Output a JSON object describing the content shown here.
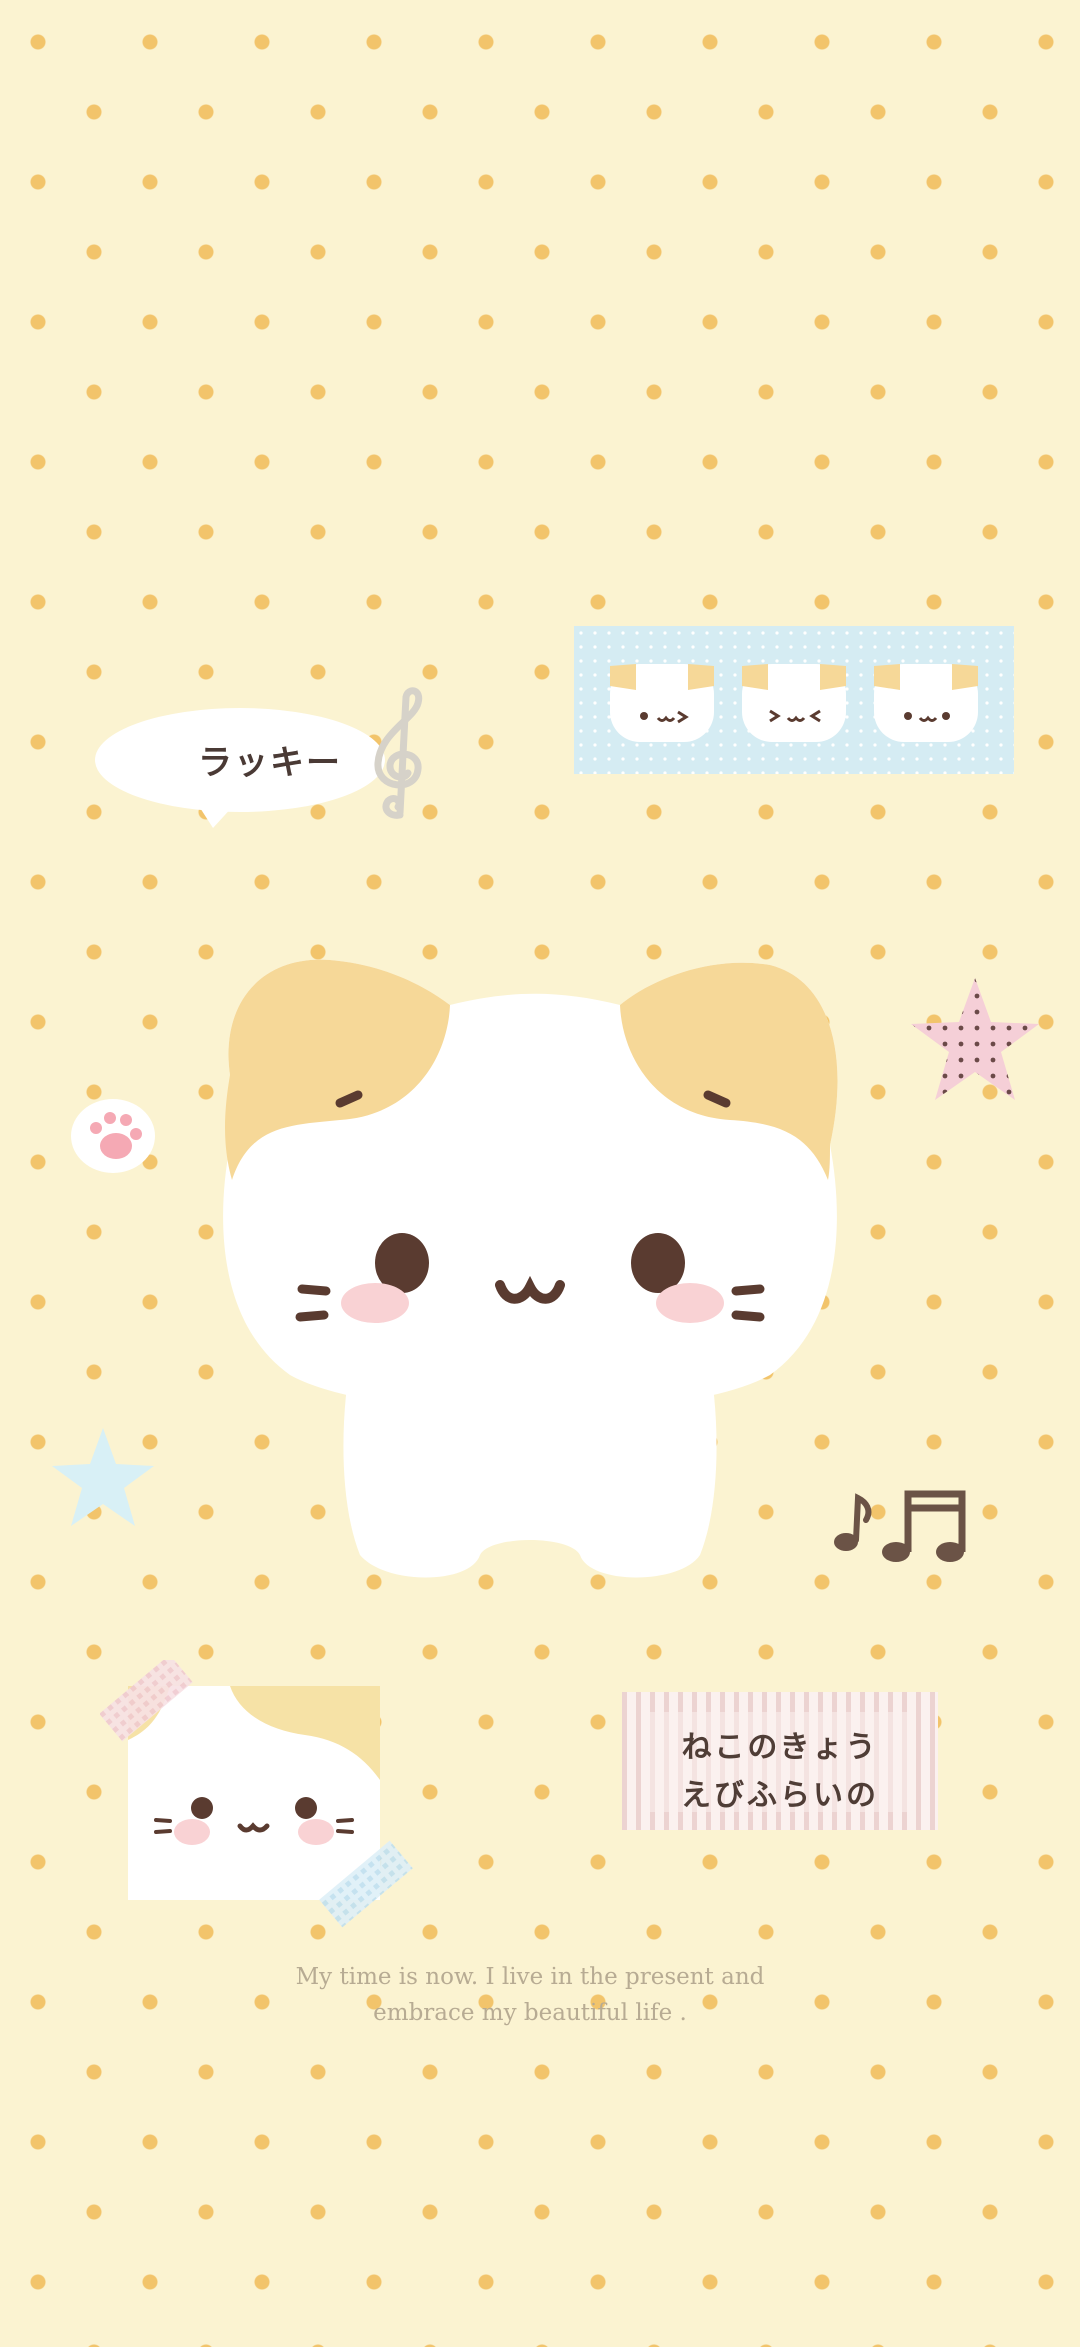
{
  "wallpaper": {
    "background_color": "#fbf3d1",
    "dot_color": "#f2c46b"
  },
  "speech_bubble": {
    "text": "ラッキー"
  },
  "sticker_label": {
    "line1": "ねこのきょう",
    "line2": "えびふらいの"
  },
  "quote": {
    "line1": "My time is now. I live in the present and",
    "line2": "embrace  my  beautiful life ."
  },
  "icons": [
    "treble-clef-icon",
    "music-notes-icon",
    "paw-icon",
    "pink-star-icon",
    "blue-star-icon"
  ]
}
